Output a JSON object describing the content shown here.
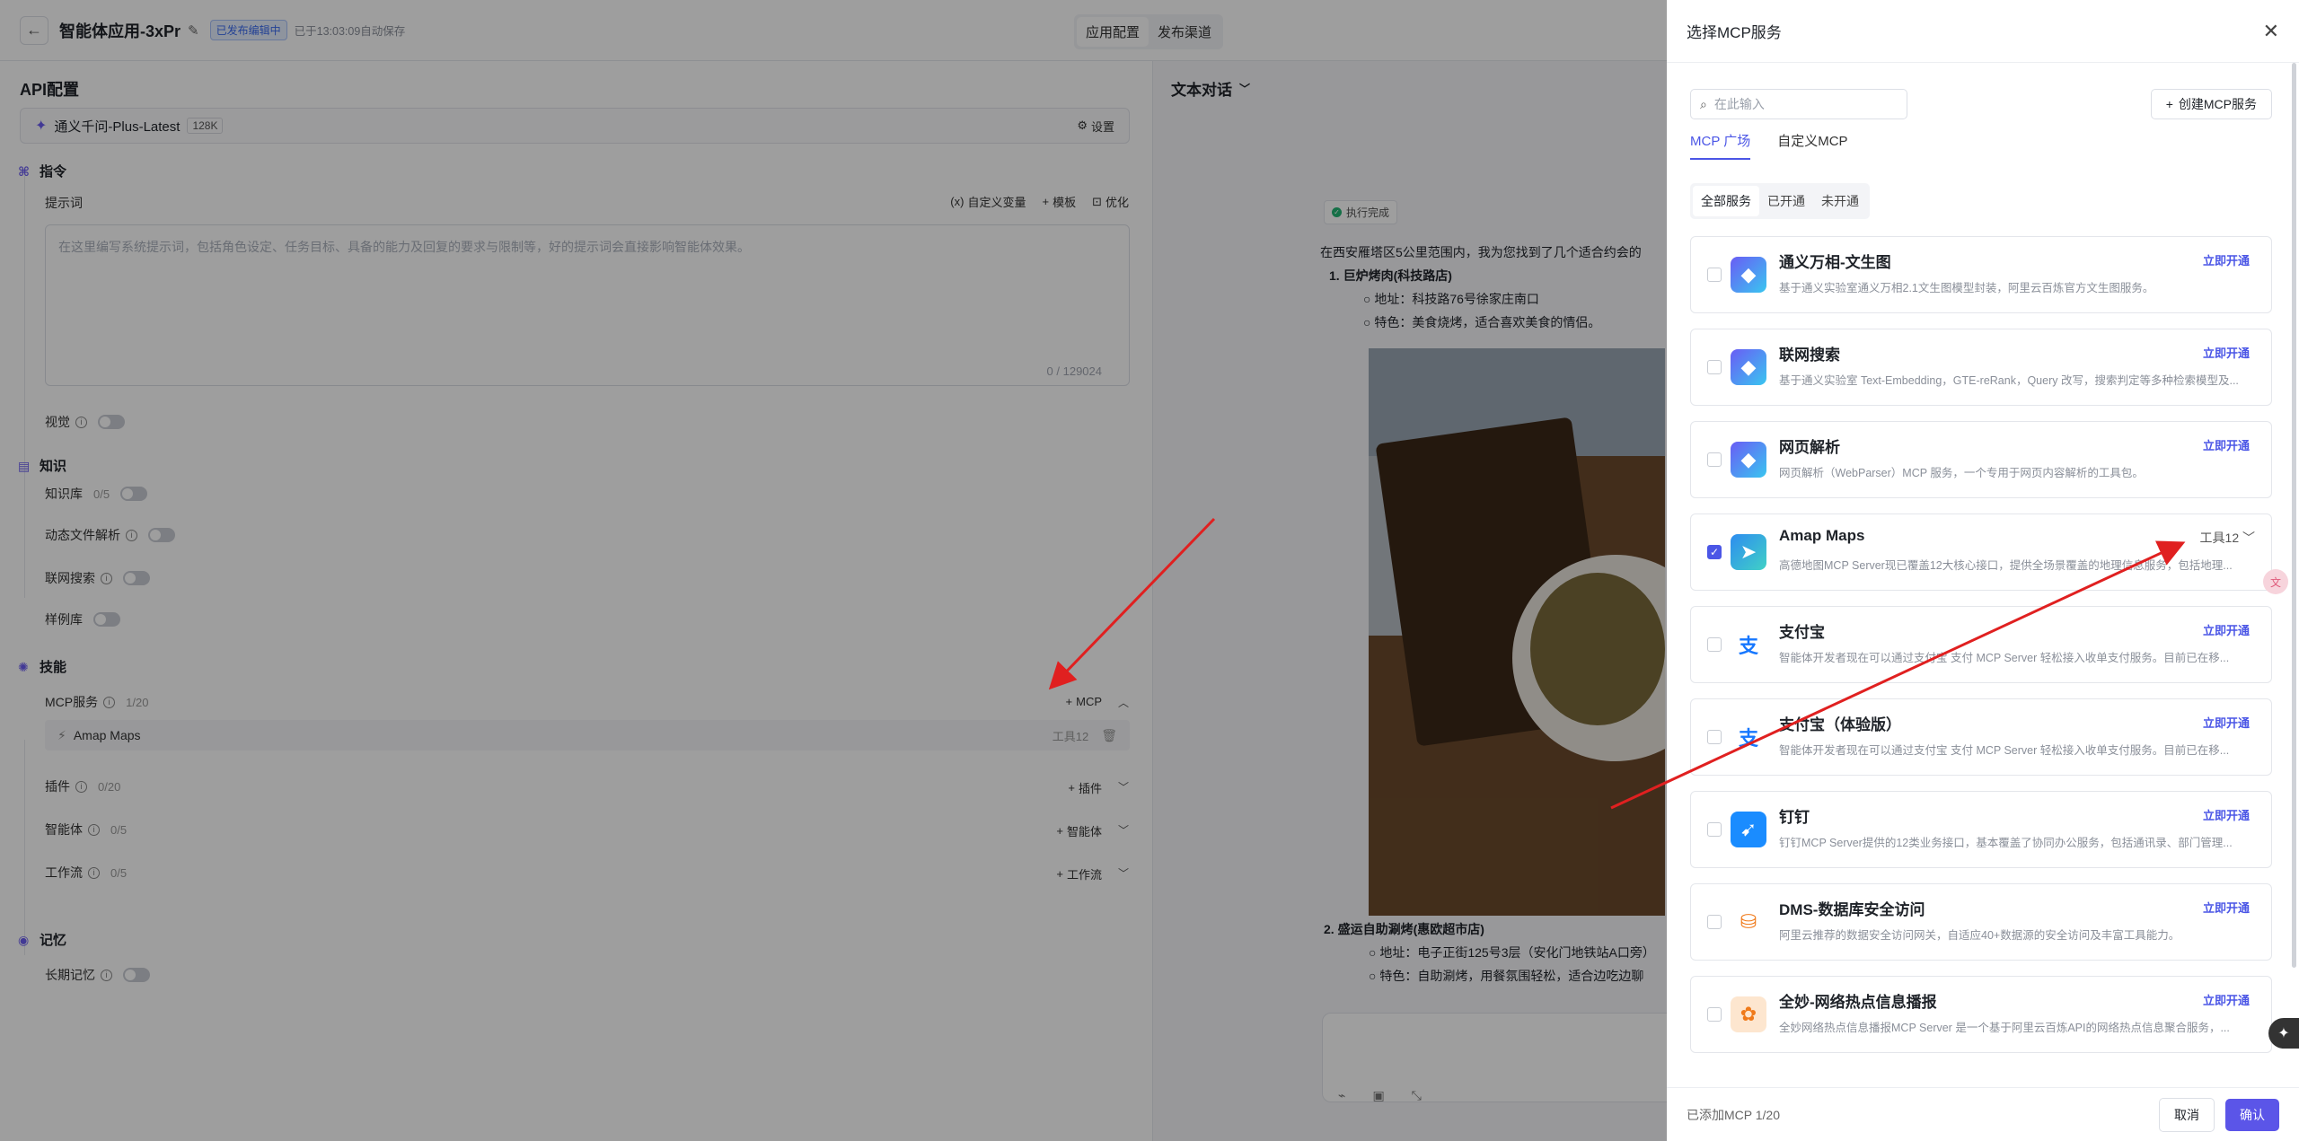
{
  "header": {
    "title": "智能体应用-3xPr",
    "status_badge": "已发布编辑中",
    "saved_text": "已于13:03:09自动保存",
    "tabs": [
      "应用配置",
      "发布渠道"
    ]
  },
  "left": {
    "section_title": "API配置",
    "model": {
      "name": "通义千问-Plus-Latest",
      "context": "128K",
      "settings_label": "设置"
    },
    "instruction": {
      "group_label": "指令",
      "prompt_label": "提示词",
      "actions": [
        "自定义变量",
        "模板",
        "优化"
      ],
      "placeholder": "在这里编写系统提示词，包括角色设定、任务目标、具备的能力及回复的要求与限制等，好的提示词会直接影响智能体效果。",
      "counter": "0 / 129024"
    },
    "vision_label": "视觉",
    "knowledge": {
      "group_label": "知识",
      "kb_label": "知识库",
      "kb_count": "0/5",
      "dynamic_file_label": "动态文件解析",
      "web_search_label": "联网搜索",
      "examples_label": "样例库"
    },
    "skills": {
      "group_label": "技能",
      "mcp_label": "MCP服务",
      "mcp_count": "1/20",
      "mcp_add": "MCP",
      "mcp_item": {
        "name": "Amap Maps",
        "tools": "工具12"
      },
      "plugin_label": "插件",
      "plugin_count": "0/20",
      "plugin_add": "插件",
      "agent_label": "智能体",
      "agent_count": "0/5",
      "agent_add": "智能体",
      "workflow_label": "工作流",
      "workflow_count": "0/5",
      "workflow_add": "工作流"
    },
    "memory": {
      "group_label": "记忆",
      "long_term_label": "长期记忆"
    }
  },
  "chat": {
    "mode_label": "文本对话",
    "exec_status": "执行完成",
    "intro": "在西安雁塔区5公里范围内，我为您找到了几个适合约会的",
    "item1_title": "1.  巨炉烤肉(科技路店)",
    "item1_addr": "○  地址：科技路76号徐家庄南口",
    "item1_feature": "○  特色：美食烧烤，适合喜欢美食的情侣。",
    "item2_title": "2.  盛运自助涮烤(惠欧超市店)",
    "item2_addr": "○  地址：电子正街125号3层（安化门地铁站A口旁）",
    "item2_feature": "○  特色：自助涮烤，用餐氛围轻松，适合边吃边聊"
  },
  "drawer": {
    "title": "选择MCP服务",
    "search_placeholder": "在此输入",
    "create_label": "创建MCP服务",
    "tabs": [
      "MCP 广场",
      "自定义MCP"
    ],
    "filters": [
      "全部服务",
      "已开通",
      "未开通"
    ],
    "cards": [
      {
        "name": "通义万相-文生图",
        "desc": "基于通义实验室通义万相2.1文生图模型封装，阿里云百炼官方文生图服务。",
        "action": "立即开通",
        "checked": false,
        "logo": "tongyi-logo"
      },
      {
        "name": "联网搜索",
        "desc": "基于通义实验室 Text-Embedding，GTE-reRank，Query 改写，搜索判定等多种检索模型及...",
        "action": "立即开通",
        "checked": false,
        "logo": "tongyi-logo"
      },
      {
        "name": "网页解析",
        "desc": "网页解析（WebParser）MCP 服务，一个专用于网页内容解析的工具包。",
        "action": "立即开通",
        "checked": false,
        "logo": "tongyi-logo"
      },
      {
        "name": "Amap Maps",
        "desc": "高德地图MCP Server现已覆盖12大核心接口，提供全场景覆盖的地理信息服务，包括地理...",
        "action": "工具12",
        "checked": true,
        "logo": "amap-logo"
      },
      {
        "name": "支付宝",
        "desc": "智能体开发者现在可以通过支付宝 支付 MCP Server 轻松接入收单支付服务。目前已在移...",
        "action": "立即开通",
        "checked": false,
        "logo": "alipay-logo"
      },
      {
        "name": "支付宝（体验版）",
        "desc": "智能体开发者现在可以通过支付宝 支付 MCP Server 轻松接入收单支付服务。目前已在移...",
        "action": "立即开通",
        "checked": false,
        "logo": "alipay-logo"
      },
      {
        "name": "钉钉",
        "desc": "钉钉MCP Server提供的12类业务接口，基本覆盖了协同办公服务，包括通讯录、部门管理...",
        "action": "立即开通",
        "checked": false,
        "logo": "dingtalk-logo"
      },
      {
        "name": "DMS-数据库安全访问",
        "desc": "阿里云推荐的数据安全访问网关，自适应40+数据源的安全访问及丰富工具能力。",
        "action": "立即开通",
        "checked": false,
        "logo": "dms-logo"
      },
      {
        "name": "全妙-网络热点信息播报",
        "desc": "全妙网络热点信息播报MCP Server 是一个基于阿里云百炼API的网络热点信息聚合服务，...",
        "action": "立即开通",
        "checked": false,
        "logo": "quanmiao-logo"
      }
    ],
    "footer": {
      "added": "已添加MCP 1/20",
      "cancel": "取消",
      "confirm": "确认"
    }
  },
  "colors": {
    "accent": "#4b56e6",
    "confirm": "#5b55e8",
    "arrow": "#e02020",
    "badge": "#3a6bf0"
  }
}
